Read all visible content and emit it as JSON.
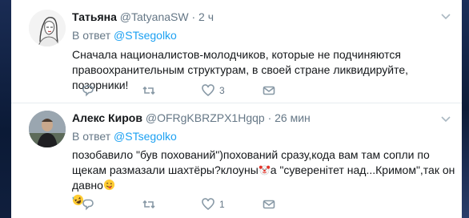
{
  "tweets": [
    {
      "name": "Татьяна",
      "handle": "@TatyanaSW",
      "separator": "·",
      "time": "2 ч",
      "reply_prefix": "В ответ",
      "reply_to": "@STsegolko",
      "text": "Сначала националистов-молодчиков, которые не подчиняются правоохранительным структурам, в своей стране ликвидируйте, позорники!",
      "likes": "3",
      "avatar_icon": "woman-sketch-avatar"
    },
    {
      "name": "Алекс Киров",
      "handle": "@OFRgKBRZPX1Hgqp",
      "separator": "·",
      "time": "26 мин",
      "reply_prefix": "В ответ",
      "reply_to": "@STsegolko",
      "text_part1": "позобавило \"був похований\")похований сразу,кода вам там сопли по щекам размазали шахтёры?клоуны",
      "text_part2": "а \"суверенітет над...Кримом\",так он давно",
      "likes": "1",
      "avatar_icon": "man-photo-avatar"
    }
  ],
  "colors": {
    "accent": "#1da1f2",
    "text": "#14171a",
    "muted": "#657786"
  },
  "icons": [
    "reply-icon",
    "retweet-icon",
    "like-icon",
    "message-icon",
    "caret-down-icon",
    "clown-emoji",
    "winking-tongue-emoji",
    "rofl-emoji"
  ]
}
